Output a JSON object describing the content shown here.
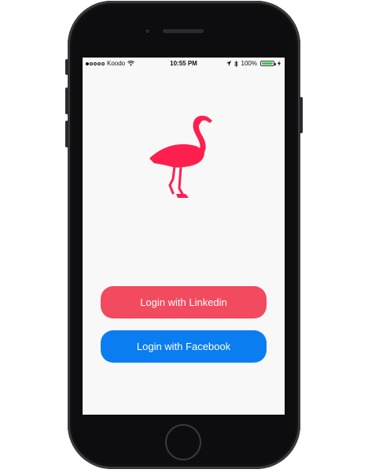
{
  "status_bar": {
    "carrier": "Koodo",
    "time": "10:55 PM",
    "battery": "100%",
    "signal_bars": 1,
    "battery_level": 1.0
  },
  "app": {
    "logo_icon": "flamingo-icon",
    "logo_color": "#ff1f4e"
  },
  "buttons": {
    "linkedin_label": "Login with Linkedin",
    "linkedin_color": "#f24a5e",
    "facebook_label": "Login with Facebook",
    "facebook_color": "#0a7ef0"
  }
}
